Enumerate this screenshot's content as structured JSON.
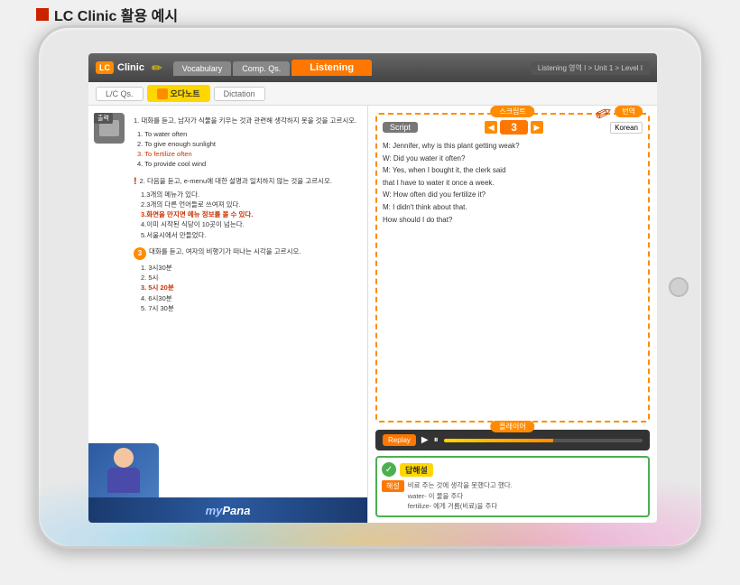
{
  "page": {
    "heading": "LC Clinic 활용 예시",
    "heading_icon_color": "#cc2200"
  },
  "tablet": {
    "home_button_visible": true
  },
  "app": {
    "logo": "LC",
    "clinic_label": "Clinic",
    "nav_tabs": [
      {
        "id": "vocabulary",
        "label": "Vocabulary",
        "active": false
      },
      {
        "id": "comp_qs",
        "label": "Comp. Qs.",
        "active": false
      },
      {
        "id": "listening",
        "label": "Listening",
        "active": true
      }
    ],
    "breadcrumb": "Listening 영역 I > Unit 1 > Level I",
    "sub_tabs": [
      {
        "id": "lc_qs",
        "label": "L/C Qs.",
        "active": false
      },
      {
        "id": "odanote",
        "label": "오다노트",
        "active": true,
        "special": true
      },
      {
        "id": "dictation",
        "label": "Dictation",
        "active": false
      }
    ]
  },
  "left_panel": {
    "output_label": "출력",
    "questions": [
      {
        "number": "1",
        "text": "대화를 듣고, 남자가 식물을 키우는 것과 관련해 생각하지 못을 것을 고르시오.",
        "options": [
          {
            "num": "1",
            "text": "To water often",
            "highlight": false
          },
          {
            "num": "2",
            "text": "To give enough sunlight",
            "highlight": false
          },
          {
            "num": "3",
            "text": "To fertilize often",
            "highlight": true
          },
          {
            "num": "4",
            "text": "To provide cool wind",
            "highlight": false
          }
        ]
      },
      {
        "number": "2",
        "text": "다음을 듣고, e-menu에 대한 설명과 일치하지 않는 것을 고르시오.",
        "options": [
          {
            "num": "1",
            "text": "3개의 메뉴가 있다.",
            "highlight": false
          },
          {
            "num": "2",
            "text": "3개의 다른 언어들로 쓰여져 있다.",
            "highlight": false
          },
          {
            "num": "3",
            "text": "화면을 만지면 메뉴 정보를 볼 수 있다.",
            "highlight": true,
            "bold": true
          },
          {
            "num": "4",
            "text": "이미 시작된 식당이 10곳이 넘는다.",
            "highlight": false
          },
          {
            "num": "5",
            "text": "서울시에서 만들었다.",
            "highlight": false
          }
        ]
      },
      {
        "number": "3",
        "text": "대화를 듣고, 여자의 비행기가 떠나는 시각을 고르시오.",
        "options": [
          {
            "num": "1",
            "text": "3시30분",
            "highlight": false
          },
          {
            "num": "2",
            "text": "5시",
            "highlight": false
          },
          {
            "num": "3",
            "text": "5시 20분",
            "highlight": true
          },
          {
            "num": "4",
            "text": "6시30분",
            "highlight": false
          },
          {
            "num": "5",
            "text": "7시 30분",
            "highlight": false
          }
        ]
      }
    ],
    "mypana": "myPana"
  },
  "right_panel": {
    "script_badge": "스크립트",
    "translate_badge": "번역",
    "script_label": "Script",
    "nav_number": "3",
    "lang_select": "Korean",
    "script_lines": [
      "M: Jennifer, why is this plant getting weak?",
      "W: Did you water it often?",
      "M: Yes, when I bought it, the clerk said",
      "     that I have to water it once a week.",
      "W: How often did you fertilize it?",
      "M: I didn't think about that.",
      "     How should I do that?"
    ],
    "player_badge": "플레이어",
    "replay_label": "Replay",
    "progress_percent": 55,
    "answer_badge": "답해설",
    "explanation_label": "해설",
    "explanation_lines": [
      "비료 주는 것에 생각을 못했다고 했다.",
      "water- 이 물을 주다",
      "fertilize- 에게 거름(비료)을 주다"
    ]
  }
}
